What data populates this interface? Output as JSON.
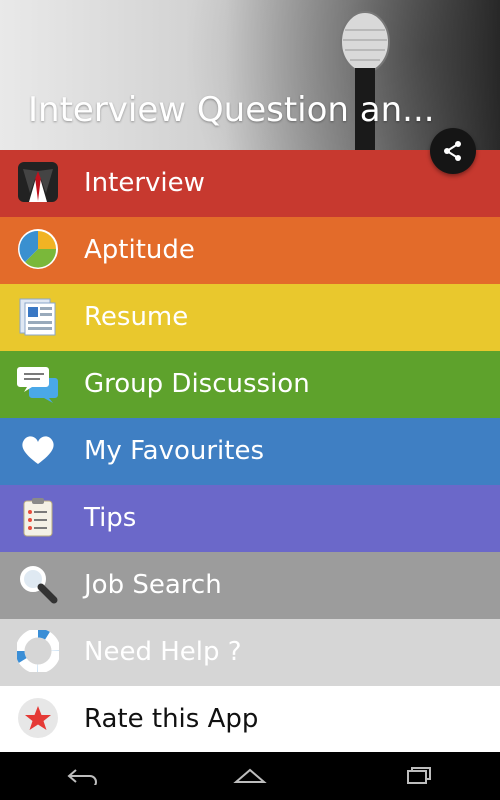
{
  "app": {
    "title": "Interview Question an..."
  },
  "menu": {
    "items": [
      {
        "label": "Interview",
        "color": "#c7392f",
        "text_color": "#ffffff",
        "icon": "suit-icon"
      },
      {
        "label": "Aptitude",
        "color": "#e36b2a",
        "text_color": "#ffffff",
        "icon": "pie-chart-icon"
      },
      {
        "label": "Resume",
        "color": "#e9c82d",
        "text_color": "#ffffff",
        "icon": "resume-icon"
      },
      {
        "label": "Group Discussion",
        "color": "#5ea22c",
        "text_color": "#ffffff",
        "icon": "chat-icon"
      },
      {
        "label": "My Favourites",
        "color": "#3f7fc3",
        "text_color": "#ffffff",
        "icon": "heart-icon"
      },
      {
        "label": "Tips",
        "color": "#6b68c9",
        "text_color": "#ffffff",
        "icon": "clipboard-icon"
      },
      {
        "label": "Job Search",
        "color": "#9c9c9c",
        "text_color": "#ffffff",
        "icon": "magnifier-icon"
      },
      {
        "label": "Need Help ?",
        "color": "#d6d6d6",
        "text_color": "#ffffff",
        "icon": "lifebuoy-icon"
      },
      {
        "label": "Rate this App",
        "color": "#ffffff",
        "text_color": "#111111",
        "icon": "star-icon"
      }
    ]
  },
  "system_nav": {
    "back_icon": "back-icon",
    "home_icon": "home-icon",
    "recents_icon": "recents-icon"
  }
}
